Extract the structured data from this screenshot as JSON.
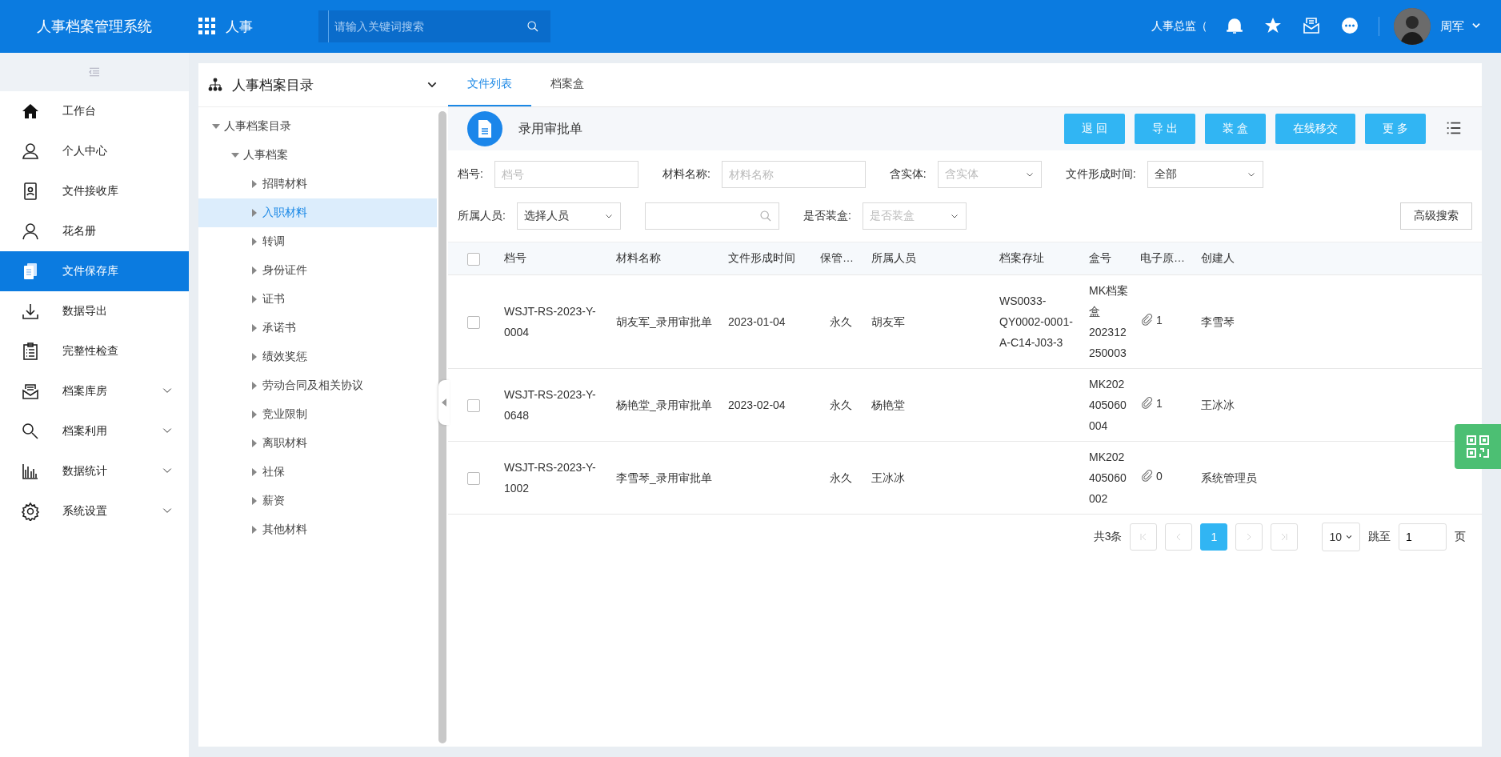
{
  "header": {
    "title": "人事档案管理系统",
    "module": "人事",
    "search_placeholder": "请输入关键词搜索",
    "role": "人事总监（",
    "user": "周军"
  },
  "sidebar": {
    "items": [
      {
        "label": "工作台",
        "selected": false,
        "expandable": false
      },
      {
        "label": "个人中心",
        "selected": false,
        "expandable": false
      },
      {
        "label": "文件接收库",
        "selected": false,
        "expandable": false
      },
      {
        "label": "花名册",
        "selected": false,
        "expandable": false
      },
      {
        "label": "文件保存库",
        "selected": true,
        "expandable": false
      },
      {
        "label": "数据导出",
        "selected": false,
        "expandable": false
      },
      {
        "label": "完整性检查",
        "selected": false,
        "expandable": false
      },
      {
        "label": "档案库房",
        "selected": false,
        "expandable": true
      },
      {
        "label": "档案利用",
        "selected": false,
        "expandable": true
      },
      {
        "label": "数据统计",
        "selected": false,
        "expandable": true
      },
      {
        "label": "系统设置",
        "selected": false,
        "expandable": true
      }
    ]
  },
  "tree": {
    "title": "人事档案目录",
    "nodes": [
      {
        "label": "人事档案目录",
        "expanded": true,
        "selected": false,
        "children": [
          {
            "label": "人事档案",
            "expanded": true,
            "selected": false,
            "children": [
              {
                "label": "招聘材料",
                "expanded": false,
                "selected": false
              },
              {
                "label": "入职材料",
                "expanded": false,
                "selected": true
              },
              {
                "label": "转调",
                "expanded": false,
                "selected": false
              },
              {
                "label": "身份证件",
                "expanded": false,
                "selected": false
              },
              {
                "label": "证书",
                "expanded": false,
                "selected": false
              },
              {
                "label": "承诺书",
                "expanded": false,
                "selected": false
              },
              {
                "label": "绩效奖惩",
                "expanded": false,
                "selected": false
              },
              {
                "label": "劳动合同及相关协议",
                "expanded": false,
                "selected": false
              },
              {
                "label": "竞业限制",
                "expanded": false,
                "selected": false
              },
              {
                "label": "离职材料",
                "expanded": false,
                "selected": false
              },
              {
                "label": "社保",
                "expanded": false,
                "selected": false
              },
              {
                "label": "薪资",
                "expanded": false,
                "selected": false
              },
              {
                "label": "其他材料",
                "expanded": false,
                "selected": false
              }
            ]
          }
        ]
      }
    ]
  },
  "tabs": [
    {
      "label": "文件列表",
      "selected": true
    },
    {
      "label": "档案盒",
      "selected": false
    }
  ],
  "toolbar": {
    "title": "录用审批单",
    "buttons": [
      "退 回",
      "导 出",
      "装 盒",
      "在线移交",
      "更 多"
    ]
  },
  "filters": [
    [
      {
        "label": "档号:",
        "kind": "text",
        "placeholder": "档号"
      },
      {
        "label": "材料名称:",
        "kind": "text",
        "placeholder": "材料名称"
      },
      {
        "label": "含实体:",
        "kind": "select",
        "placeholder": "含实体"
      },
      {
        "label": "文件形成时间:",
        "kind": "select",
        "value": "全部"
      }
    ],
    [
      {
        "label": "所属人员:",
        "kind": "select",
        "value": "选择人员"
      },
      {
        "kind": "search"
      },
      {
        "label": "是否装盒:",
        "kind": "select",
        "placeholder": "是否装盒"
      }
    ]
  ],
  "advanced_search": "高级搜索",
  "table": {
    "all_checked": false,
    "columns": [
      {
        "label": "档号",
        "kind": "text"
      },
      {
        "label": "材料名称",
        "kind": "text"
      },
      {
        "label": "文件形成时间",
        "kind": "text"
      },
      {
        "label": "保管…",
        "kind": "text"
      },
      {
        "label": "所属人员",
        "kind": "text"
      },
      {
        "label": "档案存址",
        "kind": "text"
      },
      {
        "label": "盒号",
        "kind": "text"
      },
      {
        "label": "电子原…",
        "kind": "attachment"
      },
      {
        "label": "创建人",
        "kind": "text"
      }
    ],
    "rows": [
      {
        "checked": false,
        "cells": [
          "WSJT-RS-2023-Y-0004",
          "胡友军_录用审批单",
          "2023-01-04",
          "永久",
          "胡友军",
          "WS0033-QY0002-0001-A-C14-J03-3",
          "MK档案盒202312250003",
          "1",
          "李雪琴"
        ]
      },
      {
        "checked": false,
        "cells": [
          "WSJT-RS-2023-Y-0648",
          "杨艳堂_录用审批单",
          "2023-02-04",
          "永久",
          "杨艳堂",
          "",
          "MK202405060004",
          "1",
          "王冰冰"
        ]
      },
      {
        "checked": false,
        "cells": [
          "WSJT-RS-2023-Y-1002",
          "李雪琴_录用审批单",
          "",
          "永久",
          "王冰冰",
          "",
          "MK202405060002",
          "0",
          "系统管理员"
        ]
      }
    ]
  },
  "pagination": {
    "total": "共3条",
    "pages": [
      {
        "label": "1",
        "selected": true
      }
    ],
    "page_size": "10",
    "jump_label": "跳至",
    "jump_value": "1",
    "page_unit": "页"
  }
}
